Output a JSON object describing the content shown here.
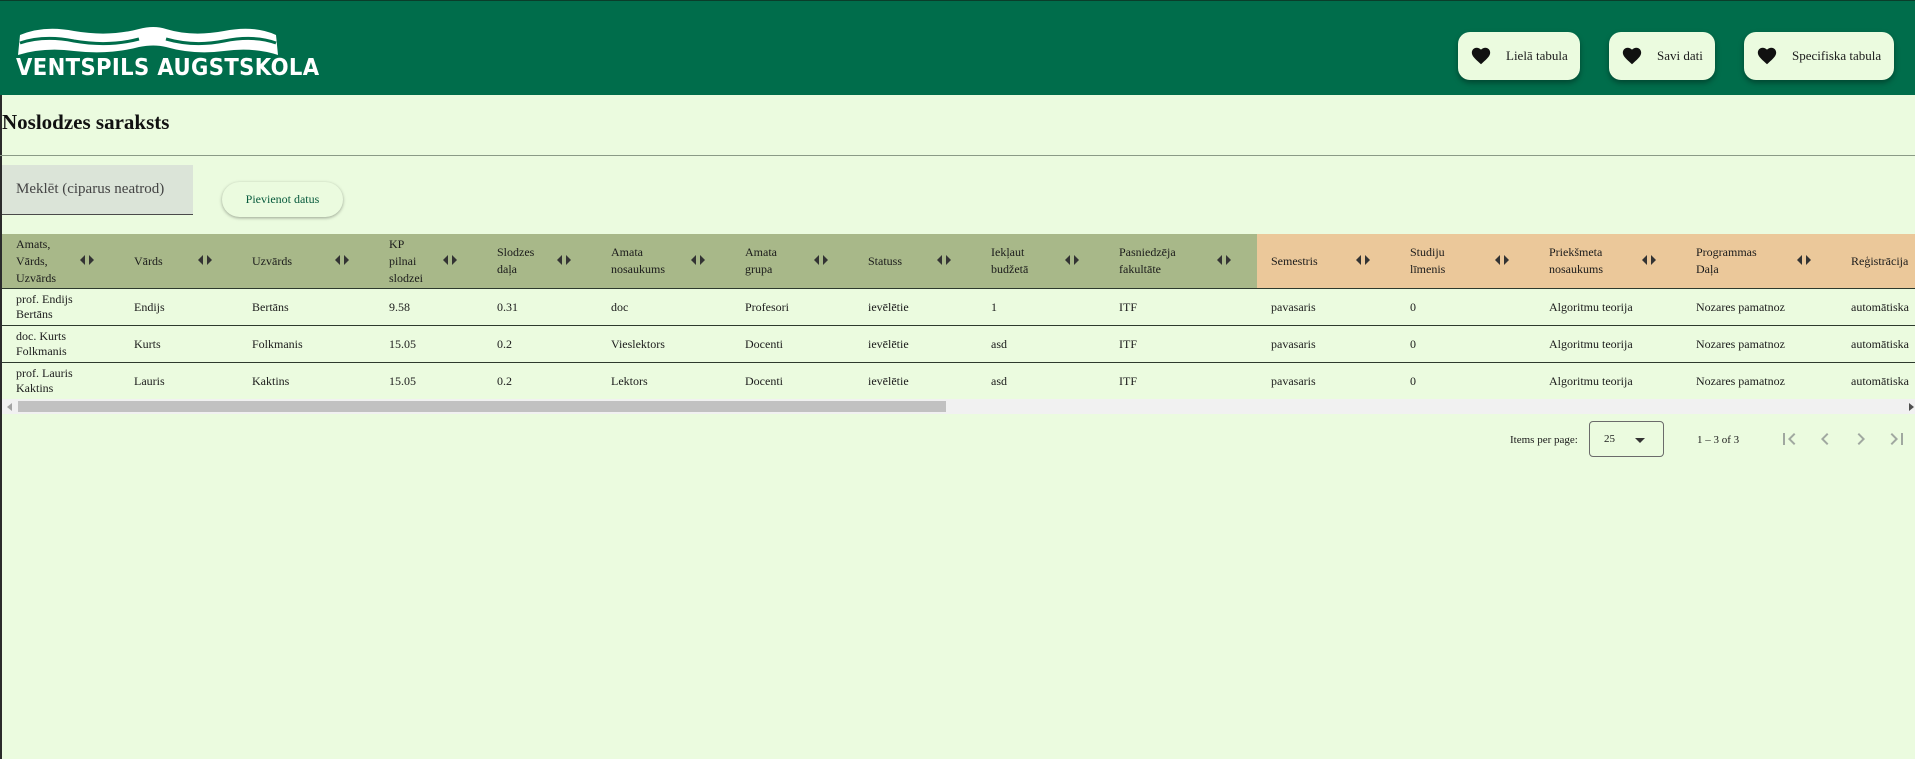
{
  "header": {
    "logo_text": "VENTSPILS AUGSTSKOLA",
    "nav": [
      {
        "label": "Lielā tabula"
      },
      {
        "label": "Savi dati"
      },
      {
        "label": "Specifiska tabula"
      }
    ]
  },
  "page": {
    "title": "Noslodzes saraksts"
  },
  "toolbar": {
    "search_placeholder": "Meklēt (ciparus neatrod)",
    "add_label": "Pievienot datus"
  },
  "table": {
    "columns": [
      {
        "label": "Amats,\nVārds,\nUzvārds",
        "group": "green"
      },
      {
        "label": "Vārds",
        "group": "green"
      },
      {
        "label": "Uzvārds",
        "group": "green"
      },
      {
        "label": "KP\npilnai\nslodzei",
        "group": "green"
      },
      {
        "label": "Slodzes\ndaļa",
        "group": "green"
      },
      {
        "label": "Amata\nnosaukums",
        "group": "green"
      },
      {
        "label": "Amata\ngrupa",
        "group": "green"
      },
      {
        "label": "Statuss",
        "group": "green"
      },
      {
        "label": "Iekļaut\nbudžetā",
        "group": "green"
      },
      {
        "label": "Pasniedzēja\nfakultāte",
        "group": "green"
      },
      {
        "label": "Semestris",
        "group": "orange"
      },
      {
        "label": "Studiju\nlīmenis",
        "group": "orange"
      },
      {
        "label": "Priekšmeta\nnosaukums",
        "group": "orange"
      },
      {
        "label": "Programmas\nDaļa",
        "group": "orange"
      },
      {
        "label": "Reģistrācija",
        "group": "orange"
      }
    ],
    "rows": [
      [
        "prof. Endijs\nBertāns",
        "Endijs",
        "Bertāns",
        "9.58",
        "0.31",
        "doc",
        "Profesori",
        "ievēlētie",
        "1",
        "ITF",
        "pavasaris",
        "0",
        "Algoritmu teorija",
        "Nozares pamatnoz",
        "automātiska"
      ],
      [
        "doc. Kurts\nFolkmanis",
        "Kurts",
        "Folkmanis",
        "15.05",
        "0.2",
        "Vieslektors",
        "Docenti",
        "ievēlētie",
        "asd",
        "ITF",
        "pavasaris",
        "0",
        "Algoritmu teorija",
        "Nozares pamatnoz",
        "automātiska"
      ],
      [
        "prof. Lauris\nKaktins",
        "Lauris",
        "Kaktins",
        "15.05",
        "0.2",
        "Lektors",
        "Docenti",
        "ievēlētie",
        "asd",
        "ITF",
        "pavasaris",
        "0",
        "Algoritmu teorija",
        "Nozares pamatnoz",
        "automātiska"
      ]
    ]
  },
  "paginator": {
    "items_per_page_label": "Items per page:",
    "items_per_page_value": "25",
    "range_label": "1 – 3 of 3"
  },
  "colors": {
    "header_bg": "#006d4b",
    "page_bg": "#ebfbdf",
    "header_green": "#a8b889",
    "header_orange": "#ebc89a"
  }
}
